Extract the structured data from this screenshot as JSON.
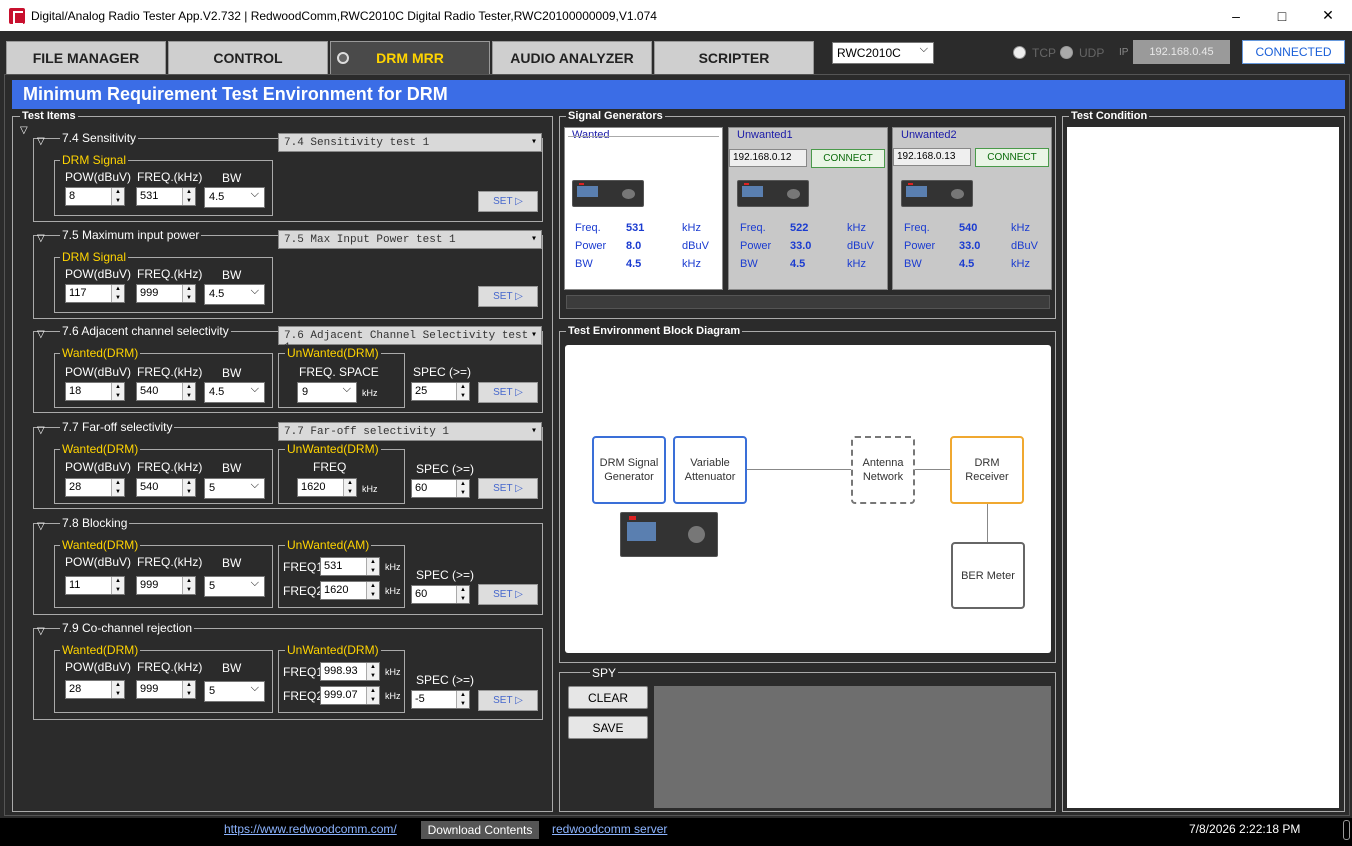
{
  "window": {
    "title": "Digital/Analog Radio Tester App.V2.732 | RedwoodComm,RWC2010C Digital Radio Tester,RWC20100000009,V1.074"
  },
  "tabs": [
    {
      "label": "FILE MANAGER"
    },
    {
      "label": "CONTROL"
    },
    {
      "label": "DRM MRR"
    },
    {
      "label": "AUDIO ANALYZER"
    },
    {
      "label": "SCRIPTER"
    }
  ],
  "device_select": "RWC2010C",
  "conn": {
    "tcp": "TCP",
    "udp": "UDP",
    "ip_label": "IP",
    "ip": "192.168.0.45",
    "status": "CONNECTED"
  },
  "header": "Minimum Requirement Test Environment for DRM",
  "groups": {
    "test_items": "Test Items",
    "signal_generators": "Signal Generators",
    "test_condition": "Test Condition",
    "block_diagram": "Test Environment Block Diagram",
    "spy": "SPY"
  },
  "common": {
    "pow": "POW(dBuV)",
    "freq": "FREQ.(kHz)",
    "bw": "BW",
    "set": "SET ▷",
    "khz": "kHz",
    "spec": "SPEC (>=)"
  },
  "tests": {
    "t74": {
      "title": "7.4 Sensitivity",
      "combo": "7.4 Sensitivity test 1",
      "sig": "DRM Signal",
      "pow": "8",
      "freq": "531",
      "bw": "4.5"
    },
    "t75": {
      "title": "7.5 Maximum input power",
      "combo": "7.5 Max Input Power test 1",
      "sig": "DRM Signal",
      "pow": "117",
      "freq": "999",
      "bw": "4.5"
    },
    "t76": {
      "title": "7.6 Adjacent channel selectivity",
      "combo": "7.6 Adjacent Channel Selectivity test 1",
      "sig": "Wanted(DRM)",
      "pow": "18",
      "freq": "540",
      "bw": "4.5",
      "unw": "UnWanted(DRM)",
      "unw_lbl": "FREQ. SPACE",
      "space": "9",
      "spec": "25"
    },
    "t77": {
      "title": "7.7 Far-off selectivity",
      "combo": "7.7 Far-off selectivity 1",
      "sig": "Wanted(DRM)",
      "pow": "28",
      "freq": "540",
      "bw": "5",
      "unw": "UnWanted(DRM)",
      "unw_lbl": "FREQ",
      "ufreq": "1620",
      "spec": "60"
    },
    "t78": {
      "title": "7.8 Blocking",
      "sig": "Wanted(DRM)",
      "pow": "11",
      "freq": "999",
      "bw": "5",
      "unw": "UnWanted(AM)",
      "f1_lbl": "FREQ1",
      "f1": "531",
      "f2_lbl": "FREQ2",
      "f2": "1620",
      "spec": "60"
    },
    "t79": {
      "title": "7.9 Co-channel rejection",
      "sig": "Wanted(DRM)",
      "pow": "28",
      "freq": "999",
      "bw": "5",
      "unw": "UnWanted(DRM)",
      "f1_lbl": "FREQ1",
      "f1": "998.93",
      "f2_lbl": "FREQ2",
      "f2": "999.07",
      "spec": "-5"
    }
  },
  "gens": {
    "labels": {
      "freq": "Freq.",
      "power": "Power",
      "bw": "BW",
      "khz": "kHz",
      "dbuv": "dBuV"
    },
    "wanted": {
      "title": "Wanted",
      "freq": "531",
      "power": "8.0",
      "bw": "4.5"
    },
    "unw1": {
      "title": "Unwanted1",
      "ip": "192.168.0.12",
      "connect": "CONNECT",
      "freq": "522",
      "power": "33.0",
      "bw": "4.5"
    },
    "unw2": {
      "title": "Unwanted2",
      "ip": "192.168.0.13",
      "connect": "CONNECT",
      "freq": "540",
      "power": "33.0",
      "bw": "4.5"
    }
  },
  "diagram": {
    "gen": "DRM Signal Generator",
    "att": "Variable Attenuator",
    "ant": "Antenna Network",
    "rx": "DRM Receiver",
    "ber": "BER Meter"
  },
  "spy": {
    "clear": "CLEAR",
    "save": "SAVE"
  },
  "status": {
    "url": "https://www.redwoodcomm.com/",
    "download": "Download Contents",
    "server": "redwoodcomm server",
    "datetime": "7/8/2026 2:22:18 PM"
  },
  "colors": {
    "header": "#3b6de6",
    "active_tab_text": "#ffd400",
    "accent_label": "#ffd400",
    "link": "#8cb4ff",
    "connect": "#0a6b0a"
  }
}
